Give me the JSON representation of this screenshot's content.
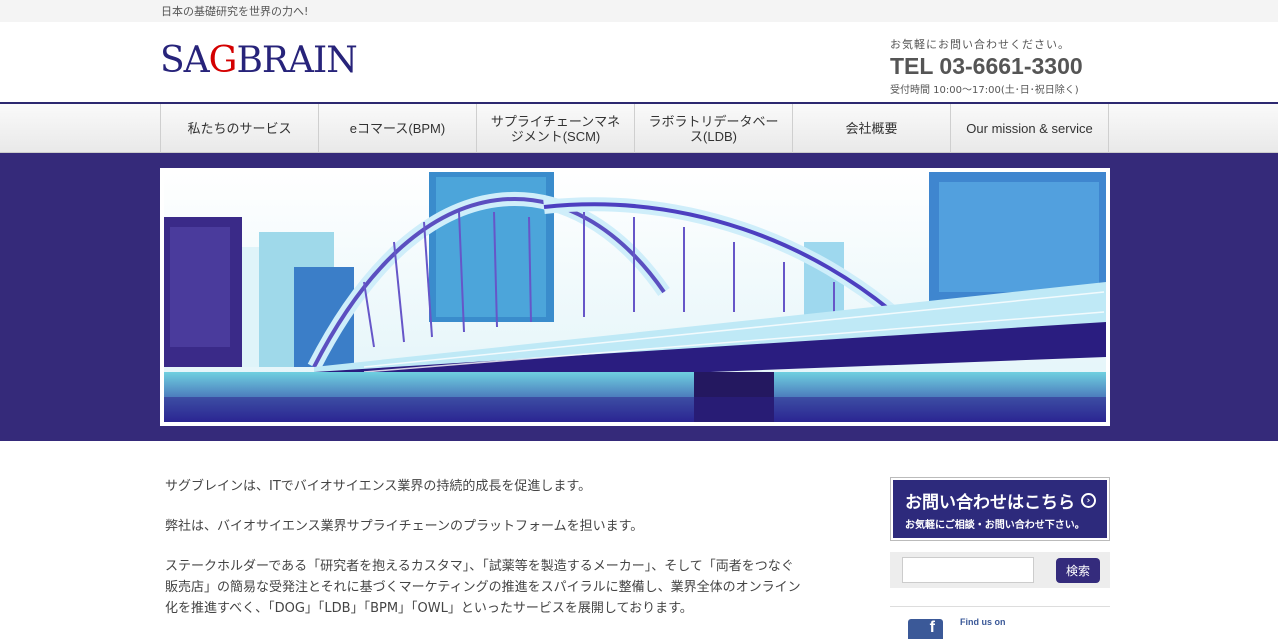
{
  "topbar": {
    "tagline": "日本の基礎研究を世界の力へ!"
  },
  "header": {
    "logo": {
      "pre": "SA",
      "accent": "G",
      "post": "BRAIN"
    },
    "contact": {
      "lead": "お気軽にお問い合わせください。",
      "tel": "TEL 03-6661-3300",
      "hours": "受付時間 10:00〜17:00(土･日･祝日除く)"
    }
  },
  "nav": {
    "items": [
      {
        "label": "私たちのサービス"
      },
      {
        "label": "eコマース(BPM)"
      },
      {
        "label": "サプライチェーンマネジメント(SCM)"
      },
      {
        "label": "ラボラトリデータベース(LDB)"
      },
      {
        "label": "会社概要"
      },
      {
        "label": "Our mission & service"
      }
    ]
  },
  "main": {
    "paragraphs": [
      "サグブレインは、ITでバイオサイエンス業界の持続的成長を促進します。",
      "弊社は、バイオサイエンス業界サプライチェーンのプラットフォームを担います。",
      "ステークホルダーである「研究者を抱えるカスタマ」、「試薬等を製造するメーカー」、そして「両者をつなぐ販売店」の簡易な受発注とそれに基づくマーケティングの推進をスパイラルに整備し、業界全体のオンライン化を推進すべく、「DOG」「LDB」「BPM」「OWL」といったサービスを展開しております。"
    ]
  },
  "side": {
    "banner": {
      "title": "お問い合わせはこちら",
      "sub": "お気軽にご相談・お問い合わせ下さい。"
    },
    "search": {
      "button": "検索",
      "value": ""
    },
    "facebook": {
      "label": "Find us on",
      "icon": "f"
    }
  },
  "colors": {
    "brand": "#2c2870",
    "accent": "#d40000",
    "band": "#352a7a"
  }
}
